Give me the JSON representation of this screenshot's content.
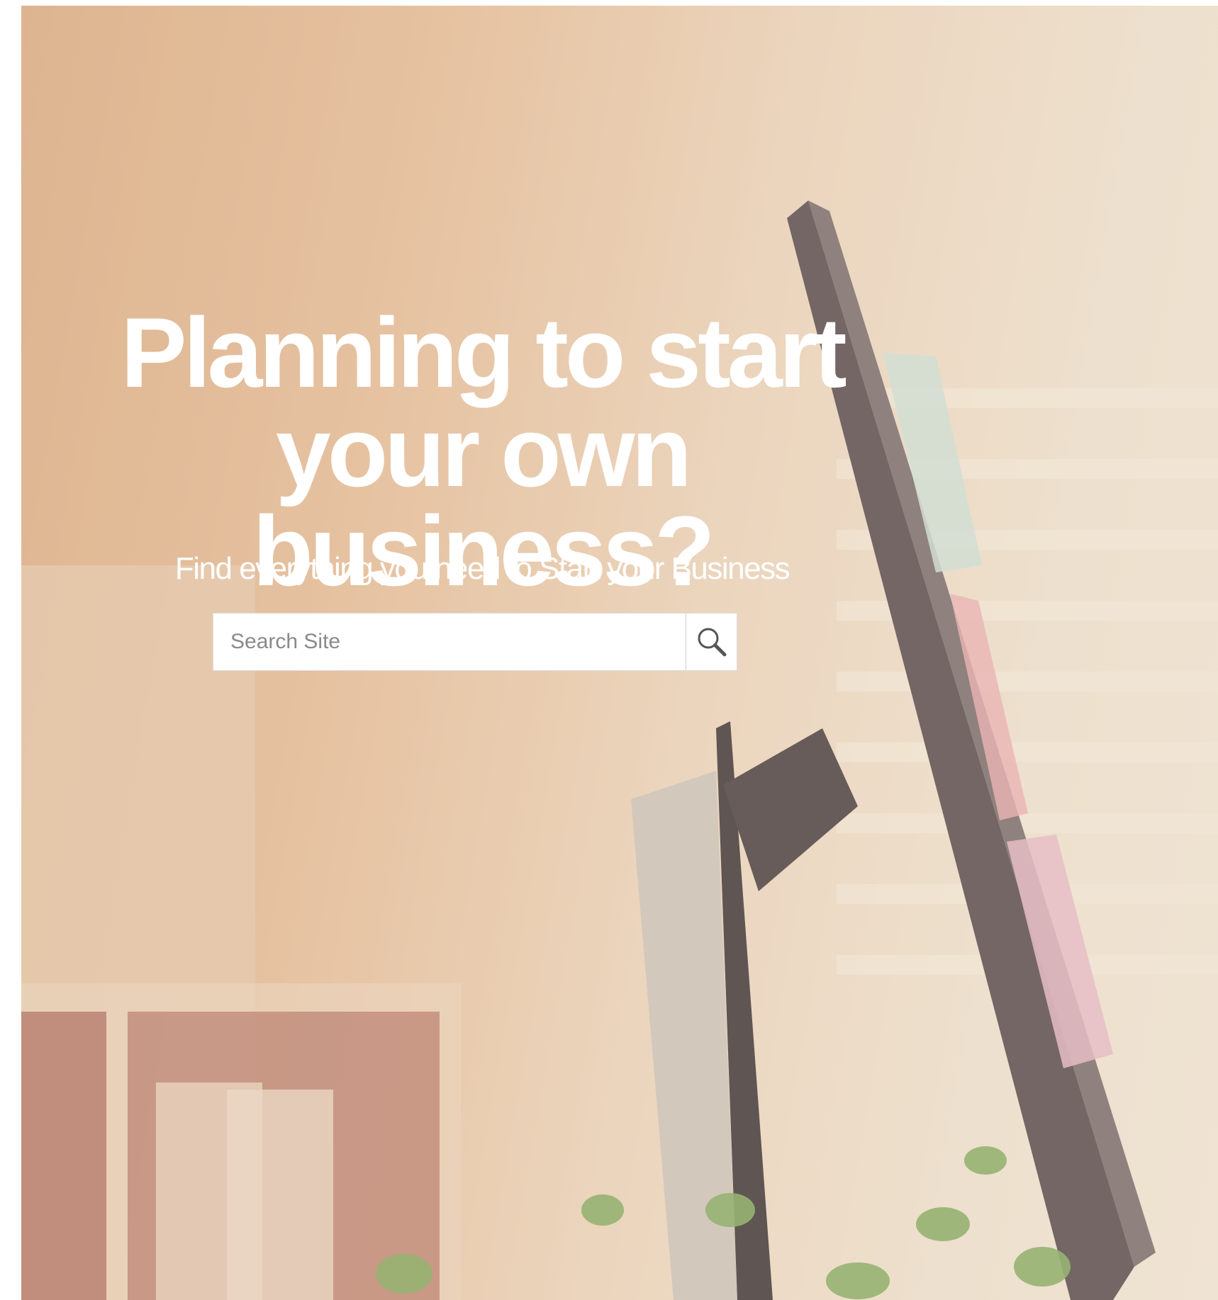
{
  "hero": {
    "title_line1": "Planning to start",
    "title_line2": "your own business?",
    "subtitle": "Find everything you need to Start your Business"
  },
  "search": {
    "placeholder": "Search Site",
    "value": "",
    "button_icon": "search-icon"
  },
  "colors": {
    "text_on_hero": "#ffffff",
    "search_background": "#ffffff",
    "placeholder": "#8a8a8a"
  }
}
